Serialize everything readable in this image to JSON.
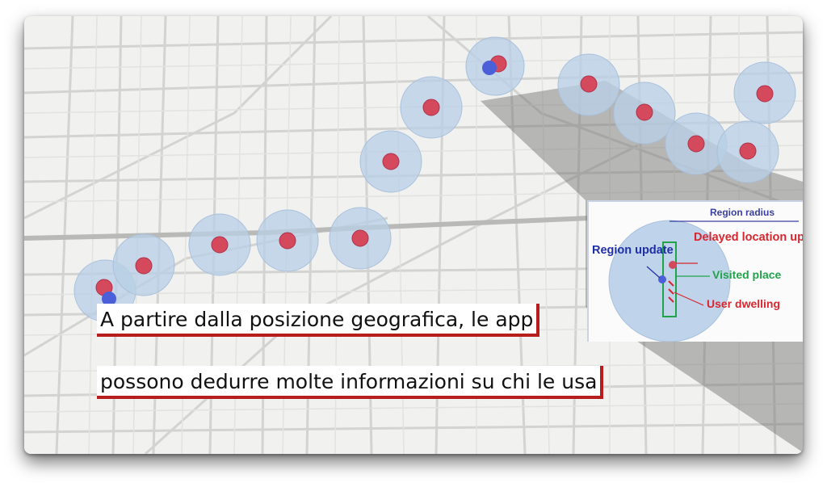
{
  "legend": {
    "region_radius": "Region radius",
    "delayed_location_update": "Delayed location update",
    "visited_place": "Visited place",
    "user_dwelling": "User dwelling",
    "region_update": "Region update"
  },
  "caption": {
    "line1": "A partire dalla posizione geografica, le app",
    "line2": "possono dedurre molte informazioni su chi le usa"
  },
  "colors": {
    "region_fill": "#b9cfe6",
    "visit_marker": "#d44a5c",
    "update_marker": "#4a5fd8",
    "caption_underline": "#b81d1d",
    "visited_green": "#21a34a",
    "region_blue": "#1f2fa6"
  },
  "map": {
    "place_count": 15,
    "icons": [
      "region-circle",
      "visit-marker",
      "region-update-marker"
    ]
  }
}
